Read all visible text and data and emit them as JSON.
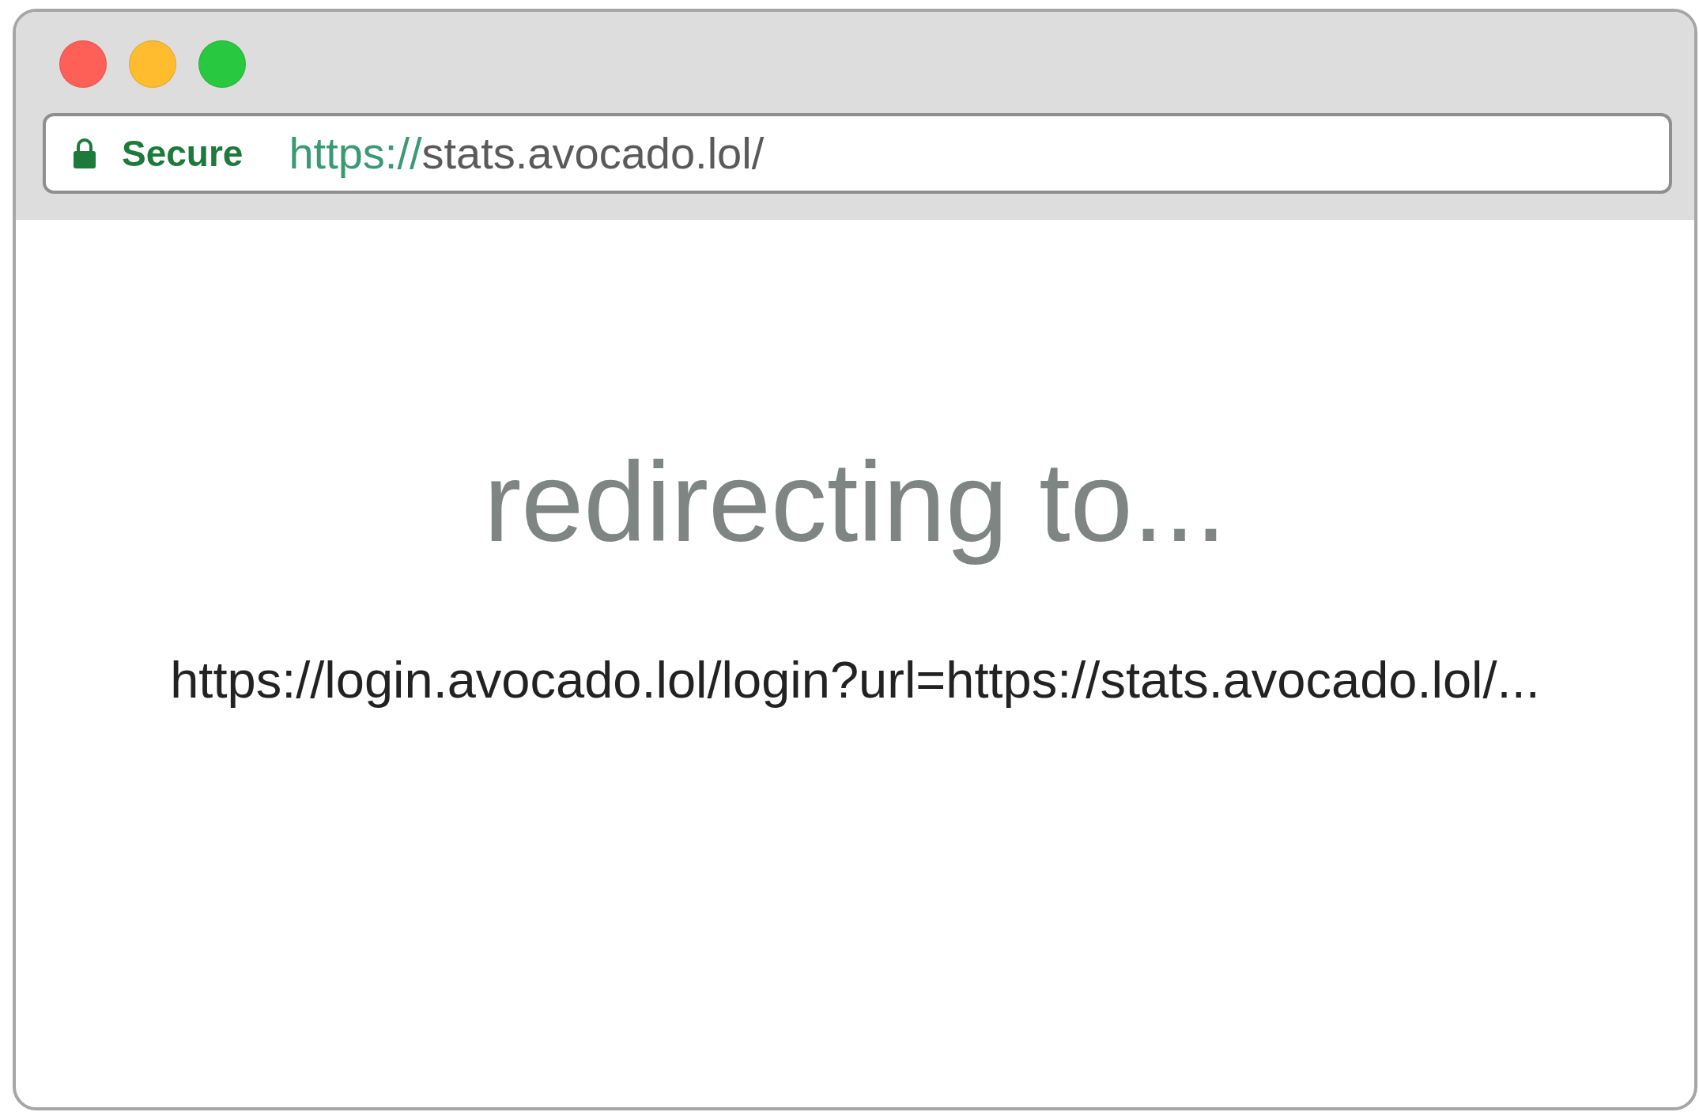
{
  "window": {
    "buttons": [
      {
        "color": "#fe5f57"
      },
      {
        "color": "#febc2e"
      },
      {
        "color": "#28c840"
      }
    ]
  },
  "address_bar": {
    "security_label": "Secure",
    "url_scheme": "https://",
    "url_rest": "stats.avocado.lol/"
  },
  "page": {
    "heading": "redirecting to...",
    "target_url": "https://login.avocado.lol/login?url=https://stats.avocado.lol/..."
  }
}
